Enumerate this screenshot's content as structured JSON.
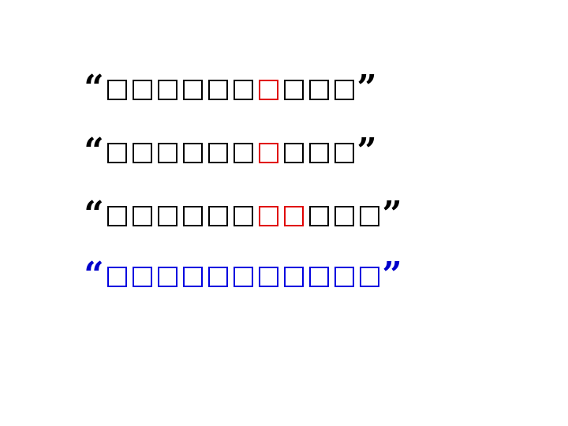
{
  "colors": {
    "text": "#000000",
    "highlight": "#e00000",
    "emphasis": "#0000e0"
  },
  "lines": [
    {
      "open_quote": "“",
      "close_quote": "”",
      "chars": [
        {
          "t": "□",
          "c": "black"
        },
        {
          "t": "□",
          "c": "black"
        },
        {
          "t": "□",
          "c": "black"
        },
        {
          "t": "□",
          "c": "black"
        },
        {
          "t": "□",
          "c": "black"
        },
        {
          "t": "□",
          "c": "black"
        },
        {
          "t": "□",
          "c": "red"
        },
        {
          "t": "□",
          "c": "black"
        },
        {
          "t": "□",
          "c": "black"
        },
        {
          "t": "□",
          "c": "black"
        }
      ]
    },
    {
      "open_quote": "“",
      "close_quote": "”",
      "chars": [
        {
          "t": "□",
          "c": "black"
        },
        {
          "t": "□",
          "c": "black"
        },
        {
          "t": "□",
          "c": "black"
        },
        {
          "t": "□",
          "c": "black"
        },
        {
          "t": "□",
          "c": "black"
        },
        {
          "t": "□",
          "c": "black"
        },
        {
          "t": "□",
          "c": "red"
        },
        {
          "t": "□",
          "c": "black"
        },
        {
          "t": "□",
          "c": "black"
        },
        {
          "t": "□",
          "c": "black"
        }
      ]
    },
    {
      "open_quote": "“",
      "close_quote": "”",
      "chars": [
        {
          "t": "□",
          "c": "black"
        },
        {
          "t": "□",
          "c": "black"
        },
        {
          "t": "□",
          "c": "black"
        },
        {
          "t": "□",
          "c": "black"
        },
        {
          "t": "□",
          "c": "black"
        },
        {
          "t": "□",
          "c": "black"
        },
        {
          "t": "□",
          "c": "red"
        },
        {
          "t": "□",
          "c": "red"
        },
        {
          "t": "□",
          "c": "black"
        },
        {
          "t": "□",
          "c": "black"
        },
        {
          "t": "□",
          "c": "black"
        }
      ]
    },
    {
      "open_quote": "“",
      "close_quote": "”",
      "chars": [
        {
          "t": "□",
          "c": "blue"
        },
        {
          "t": "□",
          "c": "blue"
        },
        {
          "t": "□",
          "c": "blue"
        },
        {
          "t": "□",
          "c": "blue"
        },
        {
          "t": "□",
          "c": "blue"
        },
        {
          "t": "□",
          "c": "blue"
        },
        {
          "t": "□",
          "c": "blue"
        },
        {
          "t": "□",
          "c": "blue"
        },
        {
          "t": "□",
          "c": "blue"
        },
        {
          "t": "□",
          "c": "blue"
        },
        {
          "t": "□",
          "c": "blue"
        }
      ]
    }
  ]
}
